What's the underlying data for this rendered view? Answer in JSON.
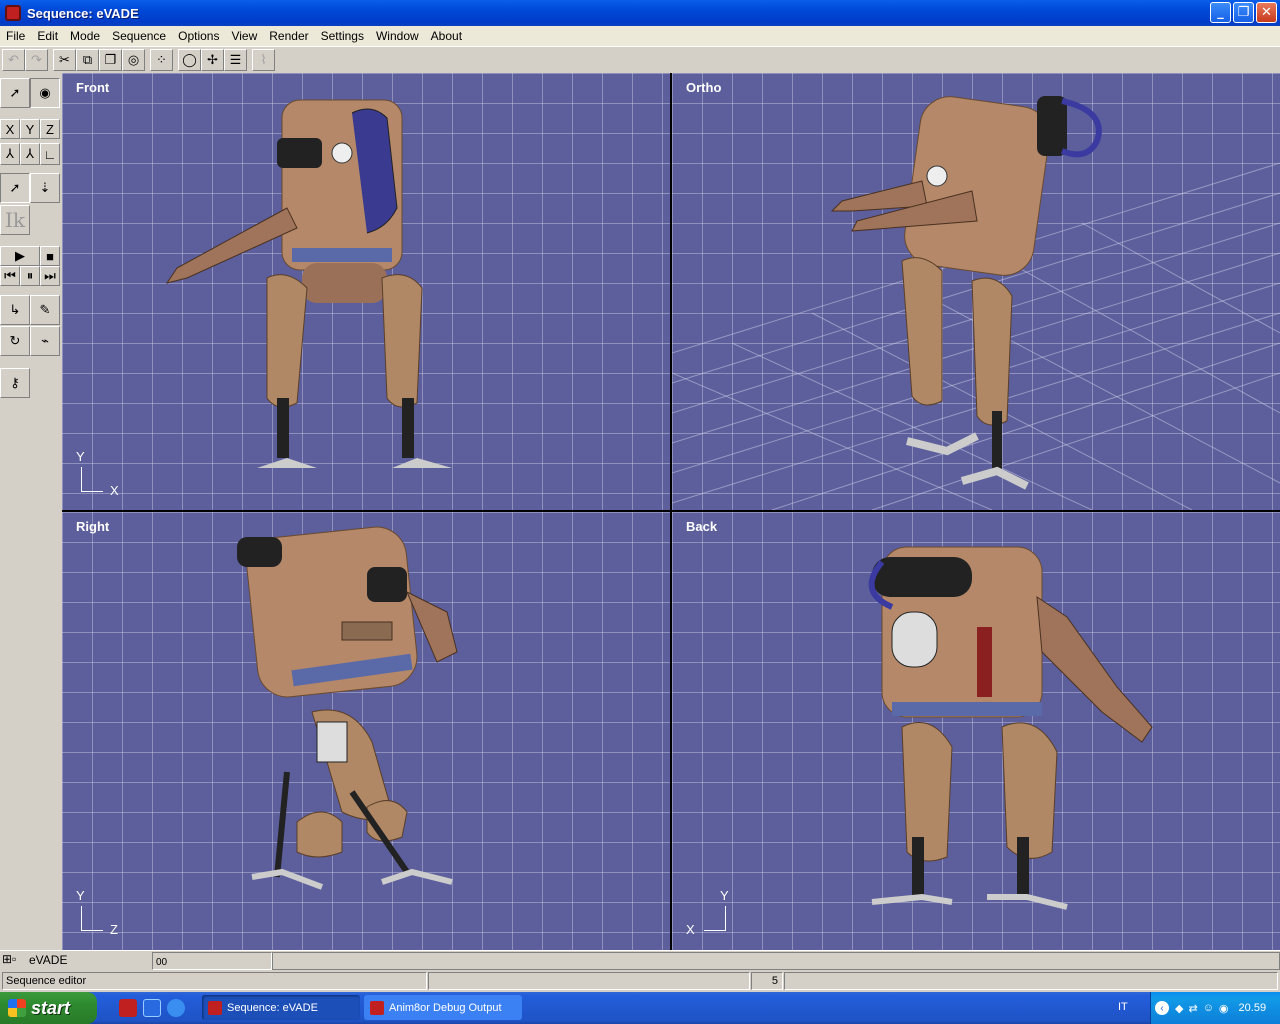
{
  "window": {
    "title": "Sequence: eVADE",
    "min": "_",
    "max": "❐",
    "close": "✕"
  },
  "menu": [
    "File",
    "Edit",
    "Mode",
    "Sequence",
    "Options",
    "View",
    "Render",
    "Settings",
    "Window",
    "About"
  ],
  "toolbar": {
    "icons": [
      "undo-icon",
      "redo-icon",
      "cut-icon",
      "copy-icon",
      "paste-icon",
      "sphere-icon",
      "grid-icon",
      "target-icon",
      "node-icon",
      "list-icon",
      "graph-icon"
    ],
    "glyphs": [
      "↶",
      "↷",
      "✂",
      "⧉",
      "❐",
      "◎",
      "⁘",
      "◯",
      "✢",
      "☰",
      "⌇"
    ]
  },
  "left_tools": {
    "axis_x": "X",
    "axis_y": "Y",
    "axis_z": "Z",
    "ik_label": "Ik",
    "play": "▶",
    "stop": "■",
    "rewind": "⏮",
    "pause": "⏸",
    "ffwd": "⏭"
  },
  "viewports": [
    {
      "label": "Front",
      "axis_v": "Y",
      "axis_h": "X"
    },
    {
      "label": "Ortho"
    },
    {
      "label": "Right",
      "axis_v": "Y",
      "axis_h": "Z"
    },
    {
      "label": "Back",
      "axis_v": "Y",
      "axis_h": "X"
    }
  ],
  "status": {
    "panel_title": "eVADE",
    "timeline_start": "00",
    "editor_label": "Sequence editor",
    "frame_value": "5"
  },
  "taskbar": {
    "start": "start",
    "tasks": [
      "Sequence: eVADE",
      "Anim8or Debug Output"
    ],
    "lang": "IT",
    "clock": "20.59"
  }
}
